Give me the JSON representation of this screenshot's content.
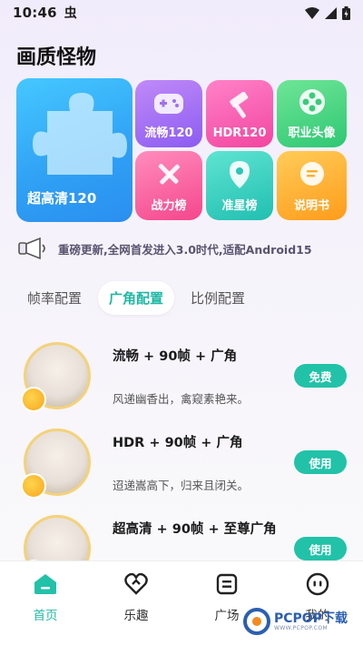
{
  "status_bar": {
    "time": "10:46",
    "notification_glyph": "虫"
  },
  "app_title": "画质怪物",
  "tiles": {
    "big": "超高清120",
    "items": [
      "流畅120",
      "HDR120",
      "职业头像",
      "战力榜",
      "准星榜",
      "说明书"
    ]
  },
  "notice": {
    "text": "重磅更新,全网首发进入3.0时代,适配Android15"
  },
  "tabs": [
    {
      "label": "帧率配置",
      "active": false
    },
    {
      "label": "广角配置",
      "active": true
    },
    {
      "label": "比例配置",
      "active": false
    }
  ],
  "configs": [
    {
      "title": "流畅 + 90帧 + 广角",
      "desc": "风递幽香出，禽窥素艳来。",
      "button": "免费"
    },
    {
      "title": "HDR + 90帧 + 广角",
      "desc": "迢递嵩高下，归来且闭关。",
      "button": "使用"
    },
    {
      "title": "超高清 + 90帧 + 至尊广角",
      "desc": "",
      "button": "使用"
    }
  ],
  "bottom_nav": [
    {
      "label": "首页",
      "active": true
    },
    {
      "label": "乐趣",
      "active": false
    },
    {
      "label": "广场",
      "active": false
    },
    {
      "label": "我的",
      "active": false
    }
  ],
  "watermark": {
    "brand": "PCPOP下载",
    "sub": "WWW.PCPOP.COM"
  },
  "colors": {
    "accent": "#22c2a8",
    "title": "#111111"
  }
}
